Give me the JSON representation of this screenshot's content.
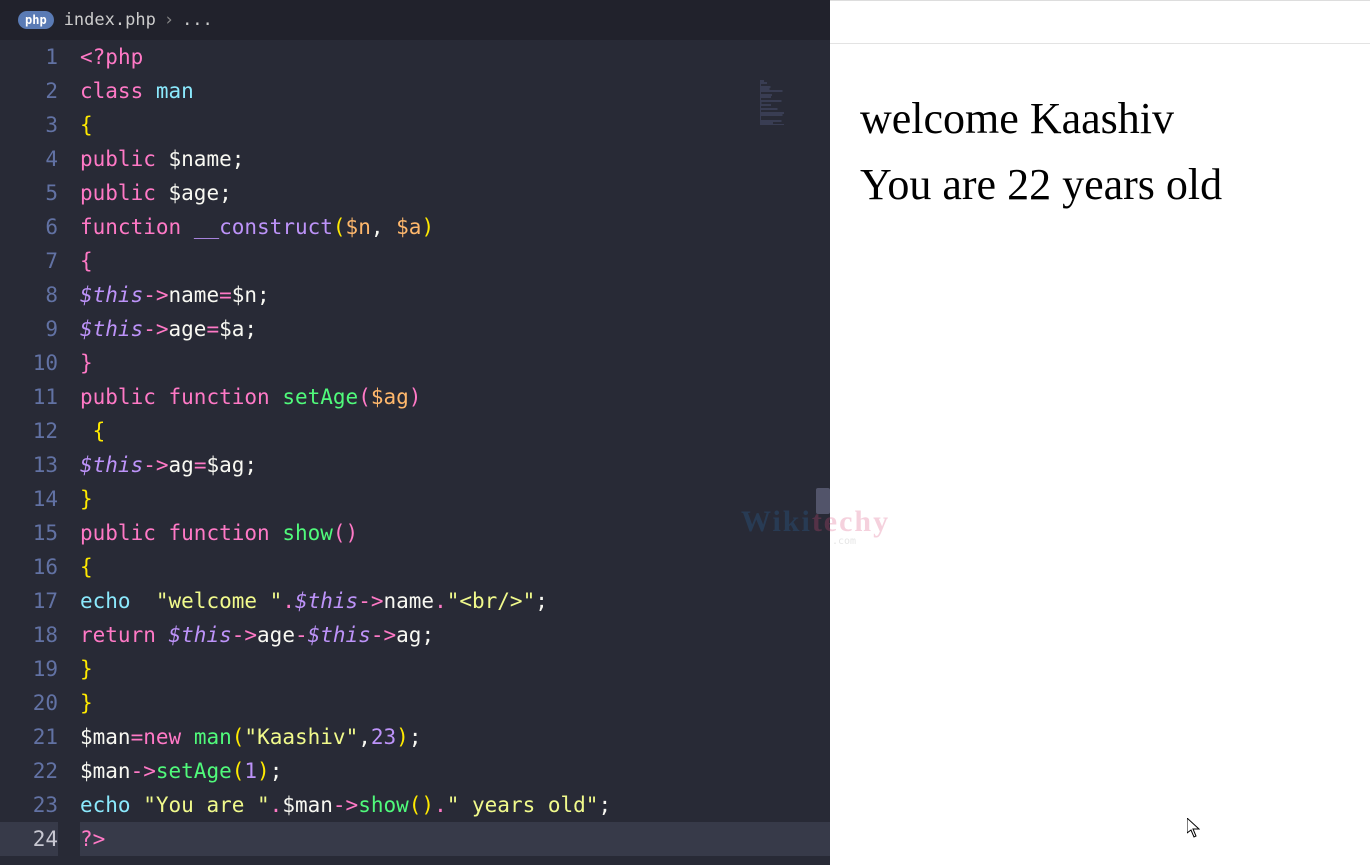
{
  "tab": {
    "badge": "php",
    "filename": "index.php",
    "separator": "›",
    "extra": "..."
  },
  "code": {
    "lines": [
      [
        {
          "c": "tok-key",
          "t": "<?"
        },
        {
          "c": "tok-key",
          "t": "php"
        }
      ],
      [
        {
          "c": "tok-key",
          "t": "class"
        },
        {
          "c": "",
          "t": " "
        },
        {
          "c": "tok-cls",
          "t": "man"
        }
      ],
      [
        {
          "c": "tok-brace-y",
          "t": "{"
        }
      ],
      [
        {
          "c": "tok-key",
          "t": "public"
        },
        {
          "c": "",
          "t": " "
        },
        {
          "c": "tok-var",
          "t": "$name"
        },
        {
          "c": "tok-punc",
          "t": ";"
        }
      ],
      [
        {
          "c": "tok-key",
          "t": "public"
        },
        {
          "c": "",
          "t": " "
        },
        {
          "c": "tok-var",
          "t": "$age"
        },
        {
          "c": "tok-punc",
          "t": ";"
        }
      ],
      [
        {
          "c": "tok-key",
          "t": "function"
        },
        {
          "c": "",
          "t": " "
        },
        {
          "c": "tok-magic",
          "t": "__construct"
        },
        {
          "c": "tok-brace-y",
          "t": "("
        },
        {
          "c": "tok-param",
          "t": "$n"
        },
        {
          "c": "tok-punc",
          "t": ","
        },
        {
          "c": "",
          "t": " "
        },
        {
          "c": "tok-param",
          "t": "$a"
        },
        {
          "c": "tok-brace-y",
          "t": ")"
        }
      ],
      [
        {
          "c": "tok-key",
          "t": "{"
        }
      ],
      [
        {
          "c": "tok-this",
          "t": "$this"
        },
        {
          "c": "tok-op",
          "t": "->"
        },
        {
          "c": "tok-var",
          "t": "name"
        },
        {
          "c": "tok-op",
          "t": "="
        },
        {
          "c": "tok-var",
          "t": "$n"
        },
        {
          "c": "tok-punc",
          "t": ";"
        }
      ],
      [
        {
          "c": "tok-this",
          "t": "$this"
        },
        {
          "c": "tok-op",
          "t": "->"
        },
        {
          "c": "tok-var",
          "t": "age"
        },
        {
          "c": "tok-op",
          "t": "="
        },
        {
          "c": "tok-var",
          "t": "$a"
        },
        {
          "c": "tok-punc",
          "t": ";"
        }
      ],
      [
        {
          "c": "tok-key",
          "t": "}"
        }
      ],
      [
        {
          "c": "tok-key",
          "t": "public"
        },
        {
          "c": "",
          "t": " "
        },
        {
          "c": "tok-key",
          "t": "function"
        },
        {
          "c": "",
          "t": " "
        },
        {
          "c": "tok-fn",
          "t": "setAge"
        },
        {
          "c": "tok-key",
          "t": "("
        },
        {
          "c": "tok-param",
          "t": "$ag"
        },
        {
          "c": "tok-key",
          "t": ")"
        }
      ],
      [
        {
          "c": "",
          "t": " "
        },
        {
          "c": "tok-brace-y",
          "t": "{"
        }
      ],
      [
        {
          "c": "tok-this",
          "t": "$this"
        },
        {
          "c": "tok-op",
          "t": "->"
        },
        {
          "c": "tok-var",
          "t": "ag"
        },
        {
          "c": "tok-op",
          "t": "="
        },
        {
          "c": "tok-var",
          "t": "$ag"
        },
        {
          "c": "tok-punc",
          "t": ";"
        }
      ],
      [
        {
          "c": "tok-brace-y",
          "t": "}"
        }
      ],
      [
        {
          "c": "tok-key",
          "t": "public"
        },
        {
          "c": "",
          "t": " "
        },
        {
          "c": "tok-key",
          "t": "function"
        },
        {
          "c": "",
          "t": " "
        },
        {
          "c": "tok-fn",
          "t": "show"
        },
        {
          "c": "tok-key",
          "t": "()"
        }
      ],
      [
        {
          "c": "tok-brace-y",
          "t": "{"
        }
      ],
      [
        {
          "c": "tok-echo",
          "t": "echo"
        },
        {
          "c": "",
          "t": "  "
        },
        {
          "c": "tok-str",
          "t": "\"welcome \""
        },
        {
          "c": "tok-op",
          "t": "."
        },
        {
          "c": "tok-this",
          "t": "$this"
        },
        {
          "c": "tok-op",
          "t": "->"
        },
        {
          "c": "tok-var",
          "t": "name"
        },
        {
          "c": "tok-op",
          "t": "."
        },
        {
          "c": "tok-str",
          "t": "\"<br/>\""
        },
        {
          "c": "tok-punc",
          "t": ";"
        }
      ],
      [
        {
          "c": "tok-key",
          "t": "return"
        },
        {
          "c": "",
          "t": " "
        },
        {
          "c": "tok-this",
          "t": "$this"
        },
        {
          "c": "tok-op",
          "t": "->"
        },
        {
          "c": "tok-var",
          "t": "age"
        },
        {
          "c": "tok-op",
          "t": "-"
        },
        {
          "c": "tok-this",
          "t": "$this"
        },
        {
          "c": "tok-op",
          "t": "->"
        },
        {
          "c": "tok-var",
          "t": "ag"
        },
        {
          "c": "tok-punc",
          "t": ";"
        }
      ],
      [
        {
          "c": "tok-brace-y",
          "t": "}"
        }
      ],
      [
        {
          "c": "tok-brace-y",
          "t": "}"
        }
      ],
      [
        {
          "c": "tok-var",
          "t": "$man"
        },
        {
          "c": "tok-op",
          "t": "="
        },
        {
          "c": "tok-key",
          "t": "new"
        },
        {
          "c": "",
          "t": " "
        },
        {
          "c": "tok-fn",
          "t": "man"
        },
        {
          "c": "tok-brace-y",
          "t": "("
        },
        {
          "c": "tok-str",
          "t": "\"Kaashiv\""
        },
        {
          "c": "tok-punc",
          "t": ","
        },
        {
          "c": "tok-num",
          "t": "23"
        },
        {
          "c": "tok-brace-y",
          "t": ")"
        },
        {
          "c": "tok-punc",
          "t": ";"
        }
      ],
      [
        {
          "c": "tok-var",
          "t": "$man"
        },
        {
          "c": "tok-op",
          "t": "->"
        },
        {
          "c": "tok-fn",
          "t": "setAge"
        },
        {
          "c": "tok-brace-y",
          "t": "("
        },
        {
          "c": "tok-num",
          "t": "1"
        },
        {
          "c": "tok-brace-y",
          "t": ")"
        },
        {
          "c": "tok-punc",
          "t": ";"
        }
      ],
      [
        {
          "c": "tok-echo",
          "t": "echo"
        },
        {
          "c": "",
          "t": " "
        },
        {
          "c": "tok-str",
          "t": "\"You are \""
        },
        {
          "c": "tok-op",
          "t": "."
        },
        {
          "c": "tok-var",
          "t": "$man"
        },
        {
          "c": "tok-op",
          "t": "->"
        },
        {
          "c": "tok-fn",
          "t": "show"
        },
        {
          "c": "tok-brace-y",
          "t": "()"
        },
        {
          "c": "tok-op",
          "t": "."
        },
        {
          "c": "tok-str",
          "t": "\" years old\""
        },
        {
          "c": "tok-punc",
          "t": ";"
        }
      ],
      [
        {
          "c": "tok-key",
          "t": "?>"
        }
      ]
    ],
    "highlightLine": 24
  },
  "output": {
    "line1": "welcome Kaashiv",
    "line2": "You are 22 years old"
  },
  "watermark": {
    "part1": "Wiki",
    "part2": "techy",
    "sub": ".com"
  }
}
